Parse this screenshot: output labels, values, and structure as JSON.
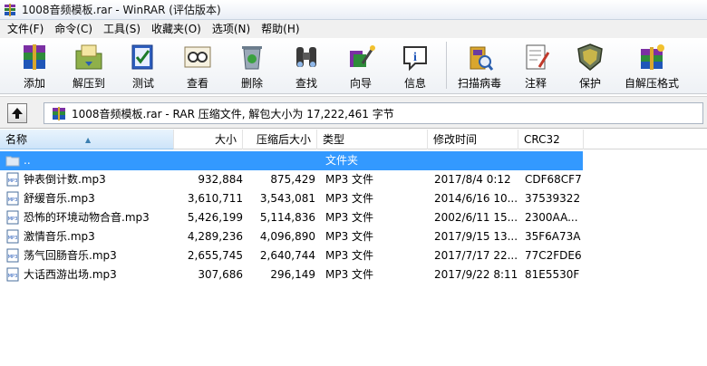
{
  "window": {
    "title": "1008音频模板.rar - WinRAR (评估版本)"
  },
  "menu": [
    "文件(F)",
    "命令(C)",
    "工具(S)",
    "收藏夹(O)",
    "选项(N)",
    "帮助(H)"
  ],
  "toolbar": {
    "add": "添加",
    "extract": "解压到",
    "test": "测试",
    "view": "查看",
    "delete": "删除",
    "find": "查找",
    "wizard": "向导",
    "info": "信息",
    "virus_scan": "扫描病毒",
    "comment": "注释",
    "protect": "保护",
    "sfx": "自解压格式"
  },
  "path": {
    "text": "1008音频模板.rar - RAR 压缩文件, 解包大小为 17,222,461 字节"
  },
  "columns": {
    "name": "名称",
    "size": "大小",
    "packed": "压缩后大小",
    "type": "类型",
    "modified": "修改时间",
    "crc": "CRC32"
  },
  "parent_row": {
    "name": "..",
    "type": "文件夹"
  },
  "files": [
    {
      "name": "钟表倒计数.mp3",
      "size": "932,884",
      "packed": "875,429",
      "type": "MP3 文件",
      "modified": "2017/8/4 0:12",
      "crc": "CDF68CF7"
    },
    {
      "name": "舒缓音乐.mp3",
      "size": "3,610,711",
      "packed": "3,543,081",
      "type": "MP3 文件",
      "modified": "2014/6/16 10...",
      "crc": "37539322"
    },
    {
      "name": "恐怖的环境动物合音.mp3",
      "size": "5,426,199",
      "packed": "5,114,836",
      "type": "MP3 文件",
      "modified": "2002/6/11 15...",
      "crc": "2300AA..."
    },
    {
      "name": "激情音乐.mp3",
      "size": "4,289,236",
      "packed": "4,096,890",
      "type": "MP3 文件",
      "modified": "2017/9/15 13...",
      "crc": "35F6A73A"
    },
    {
      "name": "荡气回肠音乐.mp3",
      "size": "2,655,745",
      "packed": "2,640,744",
      "type": "MP3 文件",
      "modified": "2017/7/17 22...",
      "crc": "77C2FDE6"
    },
    {
      "name": "大话西游出场.mp3",
      "size": "307,686",
      "packed": "296,149",
      "type": "MP3 文件",
      "modified": "2017/9/22 8:11",
      "crc": "81E5530F"
    }
  ],
  "colors": {
    "selection": "#3399ff"
  }
}
